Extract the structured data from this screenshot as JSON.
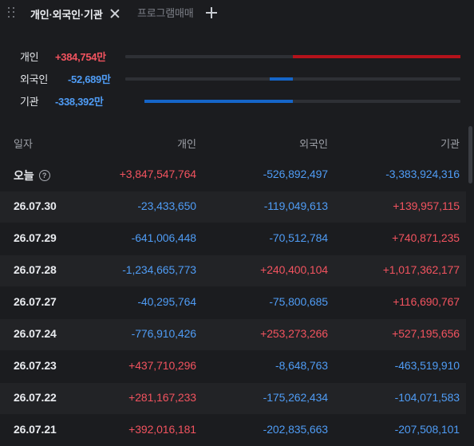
{
  "tabs": {
    "active": "개인·외국인·기관",
    "inactive": "프로그램매매"
  },
  "colors": {
    "positive": "#f2535f",
    "negative": "#4f9cf5",
    "bar_positive": "#b5121b",
    "bar_negative": "#1565c8"
  },
  "summary": [
    {
      "label": "개인",
      "value": "+384,754만",
      "sign": "pos"
    },
    {
      "label": "외국인",
      "value": "-52,689만",
      "sign": "neg"
    },
    {
      "label": "기관",
      "value": "-338,392만",
      "sign": "neg"
    }
  ],
  "table": {
    "headers": [
      "일자",
      "개인",
      "외국인",
      "기관"
    ],
    "rows": [
      {
        "date": "오늘",
        "help": true,
        "cells": [
          "+3,847,547,764",
          "-526,892,497",
          "-3,383,924,316"
        ]
      },
      {
        "date": "26.07.30",
        "cells": [
          "-23,433,650",
          "-119,049,613",
          "+139,957,115"
        ]
      },
      {
        "date": "26.07.29",
        "cells": [
          "-641,006,448",
          "-70,512,784",
          "+740,871,235"
        ]
      },
      {
        "date": "26.07.28",
        "cells": [
          "-1,234,665,773",
          "+240,400,104",
          "+1,017,362,177"
        ]
      },
      {
        "date": "26.07.27",
        "cells": [
          "-40,295,764",
          "-75,800,685",
          "+116,690,767"
        ]
      },
      {
        "date": "26.07.24",
        "cells": [
          "-776,910,426",
          "+253,273,266",
          "+527,195,656"
        ]
      },
      {
        "date": "26.07.23",
        "cells": [
          "+437,710,296",
          "-8,648,763",
          "-463,519,910"
        ]
      },
      {
        "date": "26.07.22",
        "cells": [
          "+281,167,233",
          "-175,262,434",
          "-104,071,583"
        ]
      },
      {
        "date": "26.07.21",
        "cells": [
          "+392,016,181",
          "-202,835,663",
          "-207,508,101"
        ]
      }
    ]
  }
}
